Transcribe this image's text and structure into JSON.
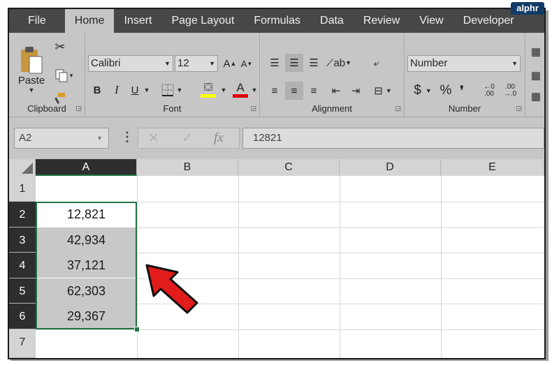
{
  "watermark": "alphr",
  "tabs": [
    "File",
    "Home",
    "Insert",
    "Page Layout",
    "Formulas",
    "Data",
    "Review",
    "View",
    "Developer"
  ],
  "ribbon": {
    "clipboard": {
      "paste_label": "Paste",
      "group_label": "Clipboard"
    },
    "font": {
      "font_name": "Calibri",
      "font_size": "12",
      "bold": "B",
      "italic": "I",
      "underline": "U",
      "fill_color": "#ffff00",
      "font_color": "#e00000",
      "group_label": "Font"
    },
    "alignment": {
      "group_label": "Alignment"
    },
    "number": {
      "format": "Number",
      "currency": "$",
      "percent": "%",
      "comma": "❜",
      "inc_decimal": "←0 .00",
      "dec_decimal": ".00 →.0",
      "group_label": "Number"
    }
  },
  "formula_bar": {
    "name_box": "A2",
    "fx": "fx",
    "value": "12821"
  },
  "columns": [
    "A",
    "B",
    "C",
    "D",
    "E"
  ],
  "rows": [
    "1",
    "2",
    "3",
    "4",
    "5",
    "6",
    "7"
  ],
  "cells_a": [
    "",
    "12,821",
    "42,934",
    "37,121",
    "62,303",
    "29,367",
    ""
  ],
  "colors": {
    "accent": "#217346",
    "arrow": "#e21b1b"
  }
}
